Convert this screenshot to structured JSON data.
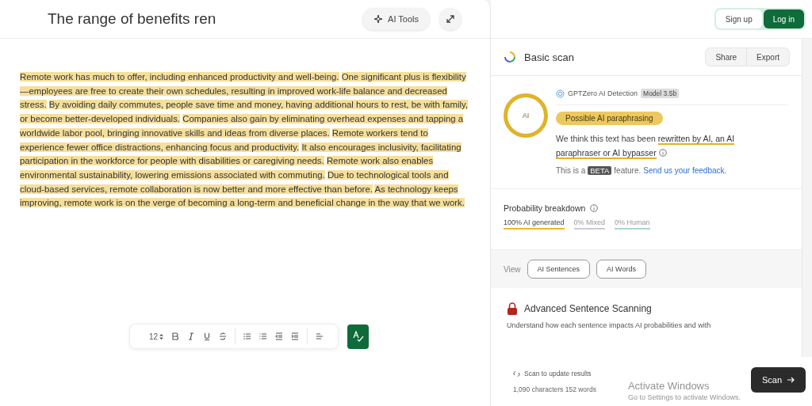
{
  "editor": {
    "title": "The range of benefits ren",
    "ai_tools": "AI Tools",
    "sentences": [
      {
        "text": "Remote work has much to offer, including enhanced productivity and well-being.",
        "highlighted": true
      },
      {
        "text": "One significant plus is flexibility—employees are free to create their own schedules, resulting in improved work-life balance and decreased stress.",
        "highlighted": true
      },
      {
        "text": "By avoiding daily commutes, people save time and money, having additional hours to rest, be with family, or become better-developed individuals.",
        "highlighted": true
      },
      {
        "text": "Companies also gain by eliminating overhead expenses and tapping a worldwide labor pool, bringing innovative skills and ideas from diverse places.",
        "highlighted": true
      },
      {
        "text": "Remote workers tend to experience fewer office distractions, enhancing focus and productivity.",
        "highlighted": true
      },
      {
        "text": "It also encourages inclusivity, facilitating participation in the workforce for people with disabilities or caregiving needs.",
        "highlighted": true
      },
      {
        "text": "Remote work also enables environmental sustainability, lowering emissions associated with commuting.",
        "highlighted": true
      },
      {
        "text": "Due to technological tools and cloud-based services, remote collaboration is now better and more effective than before.",
        "highlighted": true
      },
      {
        "text": "As technology keeps improving, remote work is on the verge of becoming a long-term and beneficial change in the way that we work.",
        "highlighted": true
      }
    ],
    "toolbar": {
      "font_size": "12"
    }
  },
  "auth": {
    "sign_up": "Sign up",
    "log_in": "Log in"
  },
  "scan": {
    "title": "Basic scan",
    "share": "Share",
    "export": "Export",
    "gauge": "AI",
    "detector": "GPTZero AI Detection",
    "model": "Model 3.5b",
    "verdict": "Possible AI paraphrasing",
    "explanation_start": "We think this text has been ",
    "explanation_mark": "rewritten by AI, an AI paraphraser or AI bypasser",
    "beta_pre": "This is a",
    "beta": "BETA",
    "beta_post": "feature.",
    "feedback": "Send us your feedback.",
    "breakdown_title": "Probability breakdown",
    "breakdown": [
      {
        "label": "100% AI generated",
        "color": "#e8b92e",
        "selected": true
      },
      {
        "label": "0% Mixed",
        "color": "#c7ccd6",
        "selected": false
      },
      {
        "label": "0% Human",
        "color": "#a8d8c8",
        "selected": false
      }
    ],
    "view_label": "View",
    "view_buttons": [
      "AI Sentences",
      "AI Words"
    ],
    "advanced_title": "Advanced Sentence Scanning",
    "advanced_text": "Understand how each sentence impacts AI probabilities and with",
    "update": "Scan to update results",
    "counts": "1,090 characters 152 words",
    "scan_button": "Scan"
  },
  "os_notice": {
    "title": "Activate Windows",
    "text": "Go to Settings to activate Windows."
  }
}
